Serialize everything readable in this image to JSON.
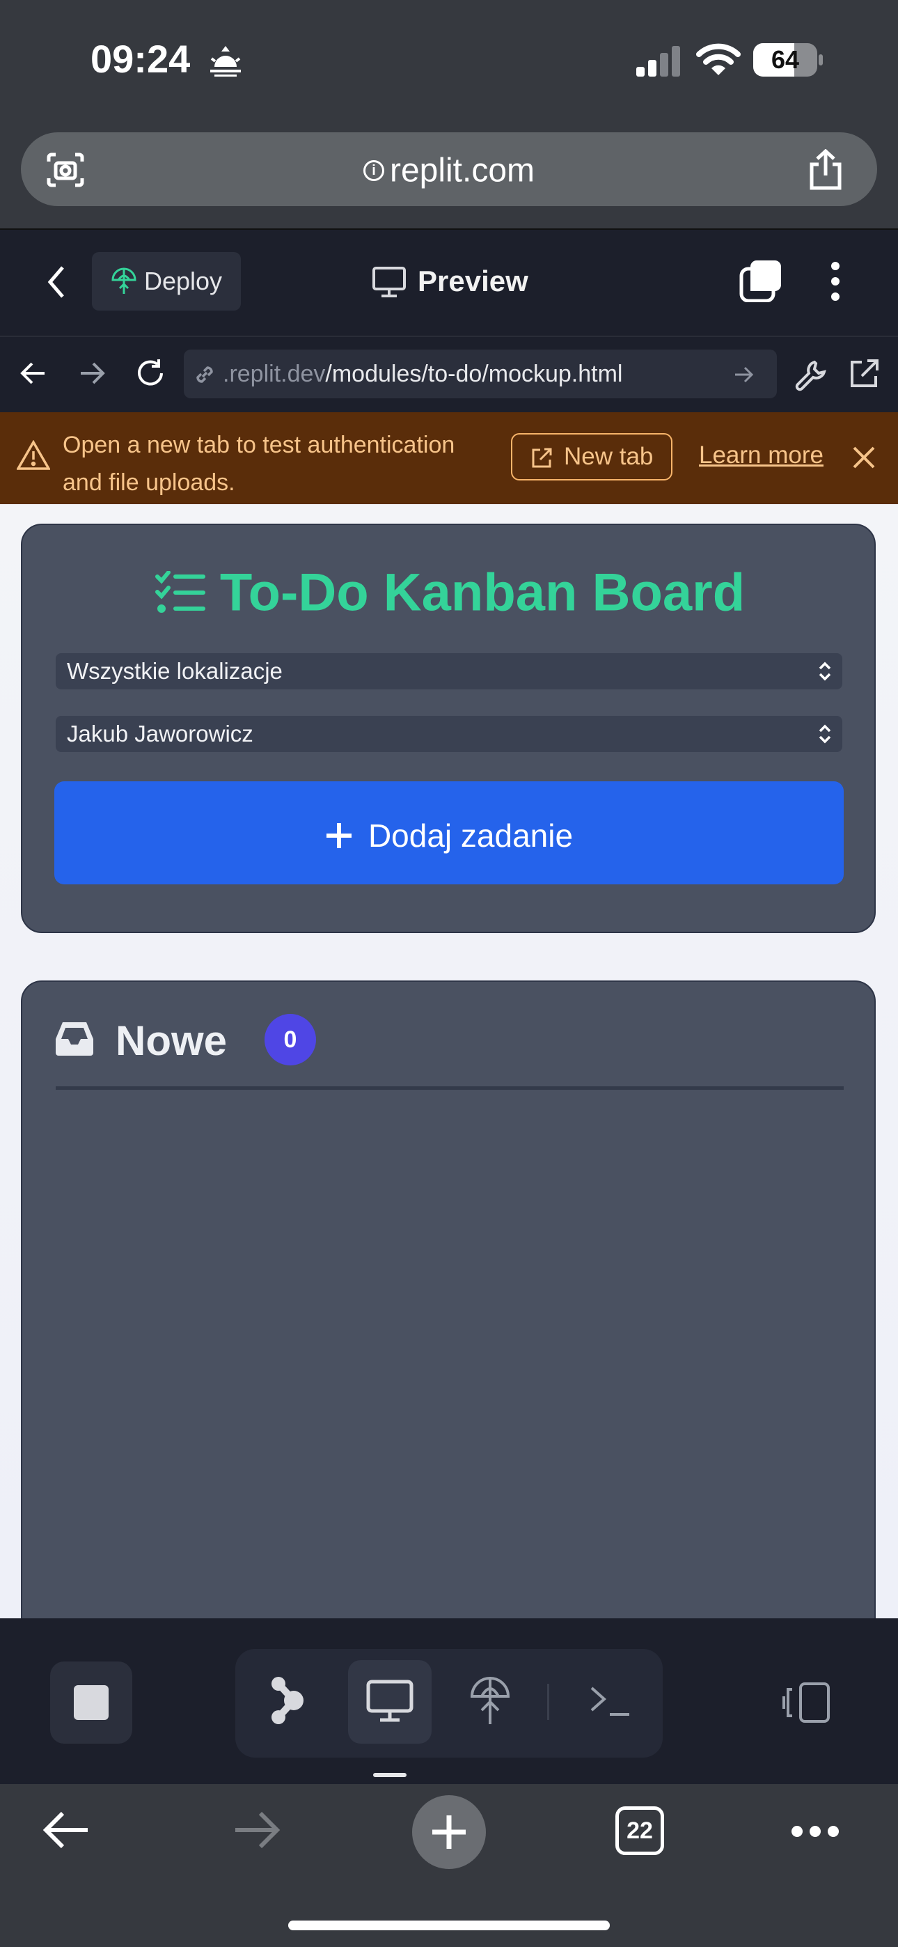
{
  "status_bar": {
    "time": "09:24",
    "battery_percent": "64",
    "battery_level": 0.64
  },
  "browser": {
    "domain": "replit.com",
    "open_tab_count": "22"
  },
  "replit_header": {
    "deploy_label": "Deploy",
    "preview_label": "Preview"
  },
  "nav": {
    "url_prefix": ".replit.dev",
    "url_path": "/modules/to-do/mockup.html"
  },
  "banner": {
    "message": "Open a new tab to test authentication and file uploads.",
    "new_tab_label": "New tab",
    "learn_more_label": "Learn more"
  },
  "app": {
    "title": "To-Do Kanban Board",
    "location_select": {
      "selected": "Wszystkie lokalizacje"
    },
    "user_select": {
      "selected": "Jakub Jaworowicz"
    },
    "add_task_label": "Dodaj zadanie",
    "columns": [
      {
        "title": "Nowe",
        "count": "0"
      }
    ]
  },
  "colors": {
    "accent_green": "#34d399",
    "primary_blue": "#2563eb",
    "badge_indigo": "#4f46e5",
    "banner_orange": "#f7c48a",
    "card_bg": "#4a5161"
  }
}
